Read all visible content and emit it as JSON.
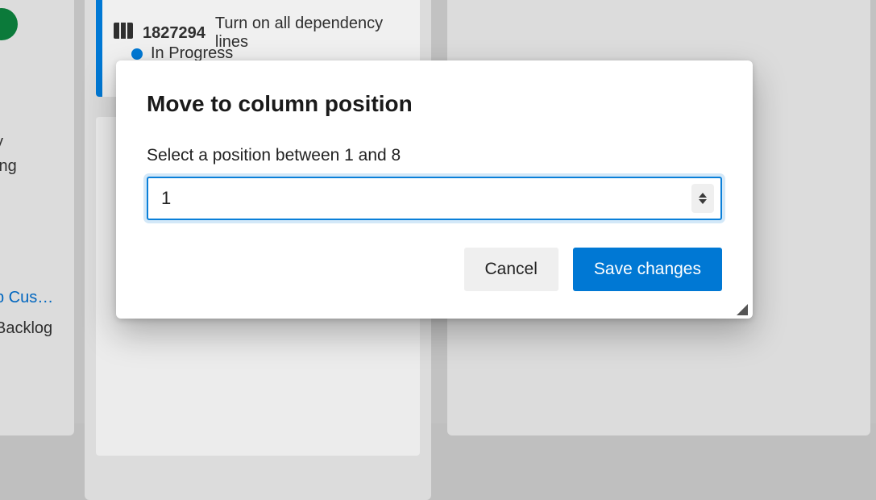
{
  "background": {
    "card": {
      "id": "1827294",
      "title": "Turn on all dependency lines",
      "status": "In Progress"
    },
    "sidebar": {
      "line1_suffix": "y",
      "line2_suffix": "ing",
      "link_truncated": "b Cus…",
      "backlog": "Backlog"
    }
  },
  "modal": {
    "title": "Move to column position",
    "label": "Select a position between 1 and 8",
    "input_value": "1",
    "input_min": 1,
    "input_max": 8,
    "cancel_label": "Cancel",
    "save_label": "Save changes"
  }
}
